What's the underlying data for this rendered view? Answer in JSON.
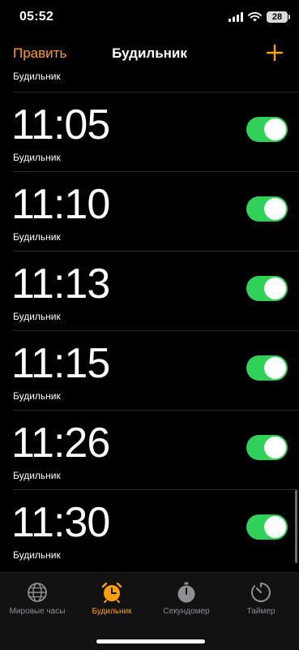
{
  "status": {
    "time": "05:52",
    "battery": "28"
  },
  "nav": {
    "edit_label": "Править",
    "title": "Будильник",
    "add_icon": "plus-icon"
  },
  "partial_row": {
    "label": "Будильник"
  },
  "alarms": [
    {
      "time": "11:05",
      "label": "Будильник",
      "enabled": true
    },
    {
      "time": "11:10",
      "label": "Будильник",
      "enabled": true
    },
    {
      "time": "11:13",
      "label": "Будильник",
      "enabled": true
    },
    {
      "time": "11:15",
      "label": "Будильник",
      "enabled": true
    },
    {
      "time": "11:26",
      "label": "Будильник",
      "enabled": true
    },
    {
      "time": "11:30",
      "label": "Будильник",
      "enabled": true
    }
  ],
  "tabs": [
    {
      "label": "Мировые часы",
      "icon": "globe-icon",
      "active": false
    },
    {
      "label": "Будильник",
      "icon": "alarm-clock-icon",
      "active": true
    },
    {
      "label": "Секундомер",
      "icon": "stopwatch-icon",
      "active": false
    },
    {
      "label": "Таймер",
      "icon": "timer-icon",
      "active": false
    }
  ],
  "colors": {
    "accent": "#ff9f0a",
    "toggle_on": "#30d158",
    "background": "#000000",
    "separator": "#2a2a2c"
  }
}
